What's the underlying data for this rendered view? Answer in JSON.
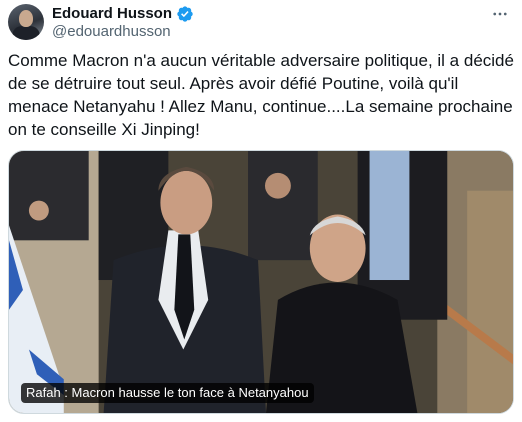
{
  "author": {
    "display_name": "Edouard Husson",
    "handle": "@edouardhusson",
    "verified": true,
    "avatar_icon": "profile-photo"
  },
  "actions": {
    "more_icon": "more-horizontal-icon"
  },
  "tweet": {
    "text": "Comme Macron n'a aucun véritable adversaire politique, il a décidé de se détruire tout seul. Après avoir défié Poutine, voilà qu'il menace Netanyahu ! Allez Manu, continue....La semaine prochaine on te conseille Xi Jinping!"
  },
  "media": {
    "caption": "Rafah : Macron hausse le ton face à Netanyahou"
  },
  "colors": {
    "verified_blue": "#1d9bf0",
    "handle_gray": "#536471",
    "text": "#0f1419",
    "border": "#cfd9de"
  }
}
